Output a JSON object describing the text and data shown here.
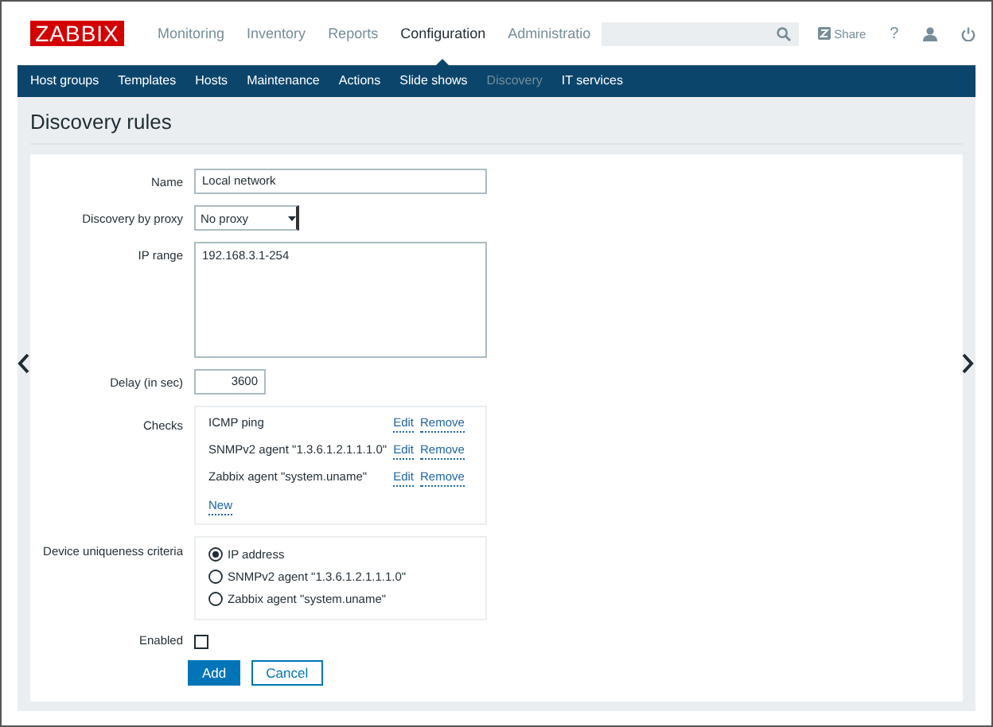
{
  "header": {
    "logo": "ZABBIX",
    "menu": [
      {
        "label": "Monitoring",
        "selected": false
      },
      {
        "label": "Inventory",
        "selected": false
      },
      {
        "label": "Reports",
        "selected": false
      },
      {
        "label": "Configuration",
        "selected": true
      },
      {
        "label": "Administratio",
        "selected": false
      }
    ],
    "share": "Share",
    "help": "?"
  },
  "subnav": [
    {
      "label": "Host groups",
      "selected": false
    },
    {
      "label": "Templates",
      "selected": false
    },
    {
      "label": "Hosts",
      "selected": false
    },
    {
      "label": "Maintenance",
      "selected": false
    },
    {
      "label": "Actions",
      "selected": false
    },
    {
      "label": "Slide shows",
      "selected": false
    },
    {
      "label": "Discovery",
      "selected": true
    },
    {
      "label": "IT services",
      "selected": false
    }
  ],
  "page_title": "Discovery rules",
  "form": {
    "name": {
      "label": "Name",
      "value": "Local network"
    },
    "proxy": {
      "label": "Discovery by proxy",
      "value": "No proxy"
    },
    "ip_range": {
      "label": "IP range",
      "value": "192.168.3.1-254"
    },
    "delay": {
      "label": "Delay (in sec)",
      "value": "3600"
    },
    "checks": {
      "label": "Checks",
      "items": [
        {
          "name": "ICMP ping",
          "edit": "Edit",
          "remove": "Remove"
        },
        {
          "name": "SNMPv2 agent \"1.3.6.1.2.1.1.1.0\"",
          "edit": "Edit",
          "remove": "Remove"
        },
        {
          "name": "Zabbix agent \"system.uname\"",
          "edit": "Edit",
          "remove": "Remove"
        }
      ],
      "new": "New"
    },
    "uniqueness": {
      "label": "Device uniqueness criteria",
      "options": [
        {
          "label": "IP address",
          "selected": true
        },
        {
          "label": "SNMPv2 agent \"1.3.6.1.2.1.1.1.0\"",
          "selected": false
        },
        {
          "label": "Zabbix agent \"system.uname\"",
          "selected": false
        }
      ]
    },
    "enabled": {
      "label": "Enabled",
      "checked": false
    },
    "buttons": [
      {
        "label": "Add",
        "kind": "primary"
      },
      {
        "label": "Cancel",
        "kind": "secondary"
      }
    ]
  }
}
